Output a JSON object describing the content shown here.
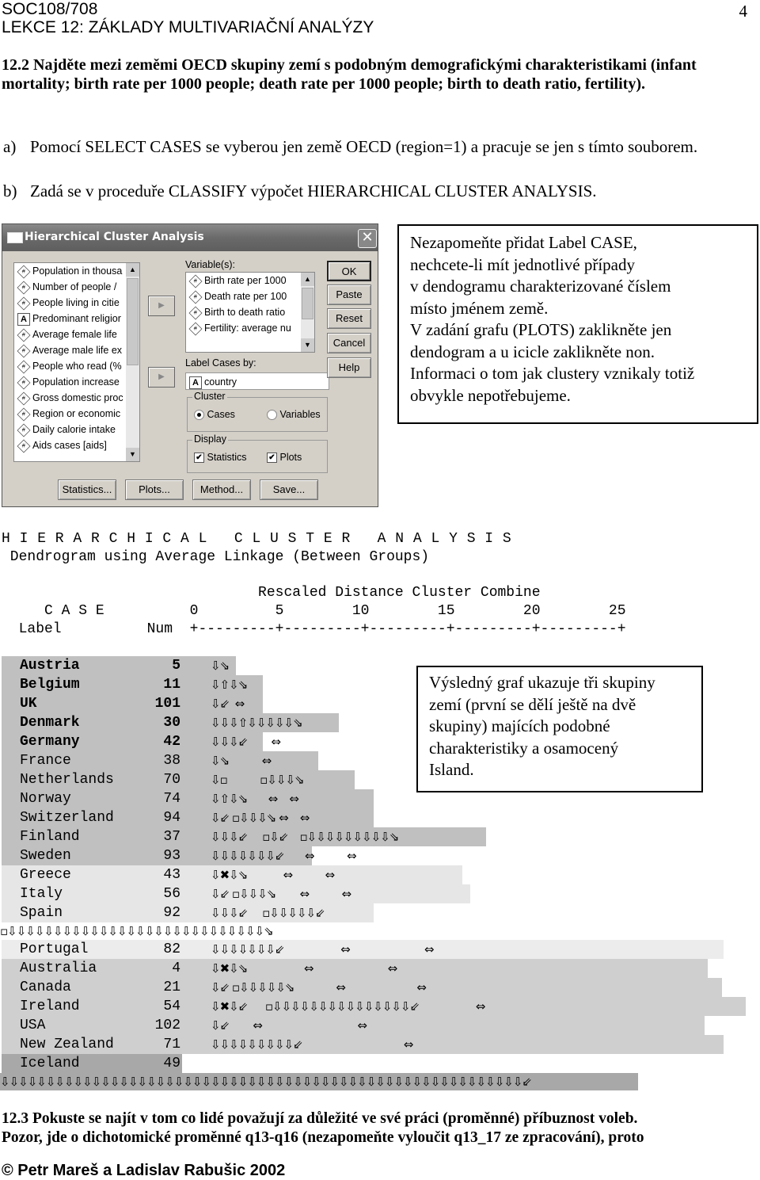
{
  "header": {
    "course": "SOC108/708",
    "lesson": "LEKCE 12: ZÁKLADY MULTIVARIAČNÍ ANALÝZY",
    "page_number": "4"
  },
  "task_12_2": {
    "text": "12.2 Najděte mezi zeměmi OECD skupiny zemí s podobným demografickými charakteristikami (infant mortality; birth rate per 1000 people; death rate per 1000 people; birth to death ratio, fertility).",
    "steps": [
      {
        "label": "a)",
        "text": "Pomocí SELECT CASES se vyberou jen země OECD (region=1) a pracuje se jen s tímto souborem."
      },
      {
        "label": "b)",
        "text": "Zadá se v proceduře CLASSIFY výpočet HIERARCHICAL CLUSTER ANALYSIS."
      }
    ]
  },
  "dialog": {
    "title": "Hierarchical Cluster Analysis",
    "close_glyph": "✕",
    "source_variables": [
      {
        "icon": "#",
        "label": "Population in thousa"
      },
      {
        "icon": "#",
        "label": "Number of people /"
      },
      {
        "icon": "#",
        "label": "People living in citie"
      },
      {
        "icon": "A",
        "label": "Predominant religior"
      },
      {
        "icon": "#",
        "label": "Average female life"
      },
      {
        "icon": "#",
        "label": "Average male life ex"
      },
      {
        "icon": "#",
        "label": "People who read (%"
      },
      {
        "icon": "#",
        "label": "Population increase"
      },
      {
        "icon": "#",
        "label": "Gross domestic proc"
      },
      {
        "icon": "#",
        "label": "Region or economic"
      },
      {
        "icon": "#",
        "label": "Daily calorie intake"
      },
      {
        "icon": "#",
        "label": "Aids cases [aids]"
      }
    ],
    "variables_label": "Variable(s):",
    "selected_variables": [
      {
        "icon": "#",
        "label": "Birth rate per 1000"
      },
      {
        "icon": "#",
        "label": "Death rate per 100"
      },
      {
        "icon": "#",
        "label": "Birth to death ratio"
      },
      {
        "icon": "#",
        "label": "Fertility: average nu"
      }
    ],
    "label_cases_label": "Label Cases by:",
    "label_cases_value": "country",
    "cluster_group": {
      "title": "Cluster",
      "options": [
        "Cases",
        "Variables"
      ],
      "selected": "Cases"
    },
    "display_group": {
      "title": "Display",
      "statistics": {
        "label": "Statistics",
        "checked": true
      },
      "plots": {
        "label": "Plots",
        "checked": true
      }
    },
    "side_buttons": [
      "OK",
      "Paste",
      "Reset",
      "Cancel",
      "Help"
    ],
    "bottom_buttons": [
      "Statistics...",
      "Plots...",
      "Method...",
      "Save..."
    ],
    "arrow_glyph": "▶",
    "scroll_up": "▲",
    "scroll_down": "▼"
  },
  "note_1": {
    "lines": [
      "Nezapomeňte přidat Label CASE,",
      "nechcete-li mít jednotlivé případy",
      "v dendogramu charakterizované číslem",
      "místo jménem země.",
      "V zadání grafu (PLOTS) zaklikněte jen",
      "dendogram a u icicle zaklikněte non.",
      "Informaci o tom jak clustery vznikaly totiž",
      "obvykle nepotřebujeme."
    ]
  },
  "dendrogram": {
    "title": "H I E R A R C H I C A L   C L U S T E R   A N A L Y S I S",
    "subtitle": " Dendrogram using Average Linkage (Between Groups)",
    "scale_caption": "                              Rescaled Distance Cluster Combine",
    "case_header": "     C A S E          0         5        10        15        20        25",
    "column_header": "  Label          Num  +---------+---------+---------+---------+---------+",
    "rows": [
      {
        "label": "Austria",
        "num": "5",
        "bold": true,
        "tree": "⇩⇘",
        "shade": "#c0c0c0"
      },
      {
        "label": "Belgium",
        "num": "11",
        "bold": true,
        "tree": "⇩⇧⇩⇘",
        "shade": "#c0c0c0"
      },
      {
        "label": "UK",
        "num": "101",
        "bold": true,
        "tree": "⇩⇙  ⇔",
        "shade": "#c0c0c0"
      },
      {
        "label": "Denmark",
        "num": "30",
        "bold": true,
        "tree": "⇩⇩⇩⇧⇩⇩⇩⇩⇩⇘",
        "shade": "#c0c0c0"
      },
      {
        "label": "Germany",
        "num": "42",
        "bold": true,
        "tree": "⇩⇩⇩⇙        ⇔",
        "shade": "#c0c0c0"
      },
      {
        "label": "France",
        "num": "38",
        "bold": false,
        "tree": "⇩⇘           ⇔",
        "shade": "#c0c0c0"
      },
      {
        "label": "Netherlands",
        "num": "70",
        "bold": false,
        "tree": "⇩▫           ▫⇩⇩⇩⇘",
        "shade": "#c0c0c0"
      },
      {
        "label": "Norway",
        "num": "74",
        "bold": false,
        "tree": "⇩⇧⇩⇘       ⇔    ⇔",
        "shade": "#c0c0c0"
      },
      {
        "label": "Switzerland",
        "num": "94",
        "bold": false,
        "tree": "⇩⇙ ▫⇩⇩⇩⇘ ⇔    ⇔",
        "shade": "#c0c0c0"
      },
      {
        "label": "Finland",
        "num": "37",
        "bold": false,
        "tree": "⇩⇩⇩⇙     ▫⇩⇙    ▫⇩⇩⇩⇩⇩⇩⇩⇩⇩⇘",
        "shade": "#c0c0c0"
      },
      {
        "label": "Sweden",
        "num": "93",
        "bold": false,
        "tree": "⇩⇩⇩⇩⇩⇩⇩⇙       ⇔           ⇔",
        "shade": "#c0c0c0"
      },
      {
        "label": "Greece",
        "num": "43",
        "bold": false,
        "tree": "⇩✖⇩⇘            ⇔           ⇔",
        "shade": "#e6e6e6"
      },
      {
        "label": "Italy",
        "num": "56",
        "bold": false,
        "tree": "⇩⇙ ▫⇩⇩⇩⇘        ⇔           ⇔",
        "shade": "#e6e6e6"
      },
      {
        "label": "Spain",
        "num": "92",
        "bold": false,
        "tree": "⇩⇩⇩⇙     ▫⇩⇩⇩⇩⇩⇙",
        "shade": "#e6e6e6"
      }
    ],
    "connector_1": "▫⇩⇩⇩⇩⇩⇩⇩⇩⇩⇩⇩⇩⇩⇩⇩⇩⇩⇩⇩⇩⇩⇩⇩⇩⇩⇩⇩⇩⇘",
    "rows2": [
      {
        "label": "Portugal",
        "num": "82",
        "bold": false,
        "tree": "⇩⇩⇩⇩⇩⇩⇩⇙                   ⇔                         ⇔",
        "shade": "#ececec"
      },
      {
        "label": "Australia",
        "num": "4",
        "bold": false,
        "tree": "⇩✖⇩⇘                   ⇔                         ⇔",
        "shade": "#cfcfcf"
      },
      {
        "label": "Canada",
        "num": "21",
        "bold": false,
        "tree": "⇩⇙ ▫⇩⇩⇩⇩⇩⇘              ⇔                        ⇔",
        "shade": "#cfcfcf"
      },
      {
        "label": "Ireland",
        "num": "54",
        "bold": false,
        "tree": "⇩✖⇩⇙      ▫⇩⇩⇩⇩⇩⇩⇩⇩⇩⇩⇩⇩⇩⇩⇩⇙                   ⇔",
        "shade": "#cfcfcf"
      },
      {
        "label": "USA",
        "num": "102",
        "bold": false,
        "tree": "⇩⇙        ⇔                                ⇔",
        "shade": "#cfcfcf"
      },
      {
        "label": "New Zealand",
        "num": "71",
        "bold": false,
        "tree": "⇩⇩⇩⇩⇩⇩⇩⇩⇩⇙                                  ⇔",
        "shade": "#cfcfcf"
      },
      {
        "label": "Iceland",
        "num": "49",
        "bold": false,
        "tree": "",
        "shade": "#a8a8a8"
      }
    ],
    "connector_2": "⇩⇩⇩⇩⇩⇩⇩⇩⇩⇩⇩⇩⇩⇩⇩⇩⇩⇩⇩⇩⇩⇩⇩⇩⇩⇩⇩⇩⇩⇩⇩⇩⇩⇩⇩⇩⇩⇩⇩⇩⇩⇩⇩⇩⇩⇩⇩⇩⇩⇩⇩⇩⇩⇩⇩⇩⇩⇙"
  },
  "note_2": {
    "lines": [
      "Výsledný graf ukazuje tři skupiny",
      "zemí (první se dělí ještě na dvě",
      "skupiny) majících podobné",
      "charakteristiky a osamocený",
      "Island."
    ]
  },
  "task_12_3": {
    "line1": "12.3 Pokuste se najít v tom co lidé považují za důležité ve své práci (proměnné) příbuznost voleb.",
    "line2": "Pozor, jde o dichotomické proměnné q13-q16 (nezapomeňte vyloučit q13_17 ze zpracování), proto"
  },
  "footer": "© Petr Mareš a Ladislav Rabušic 2002"
}
